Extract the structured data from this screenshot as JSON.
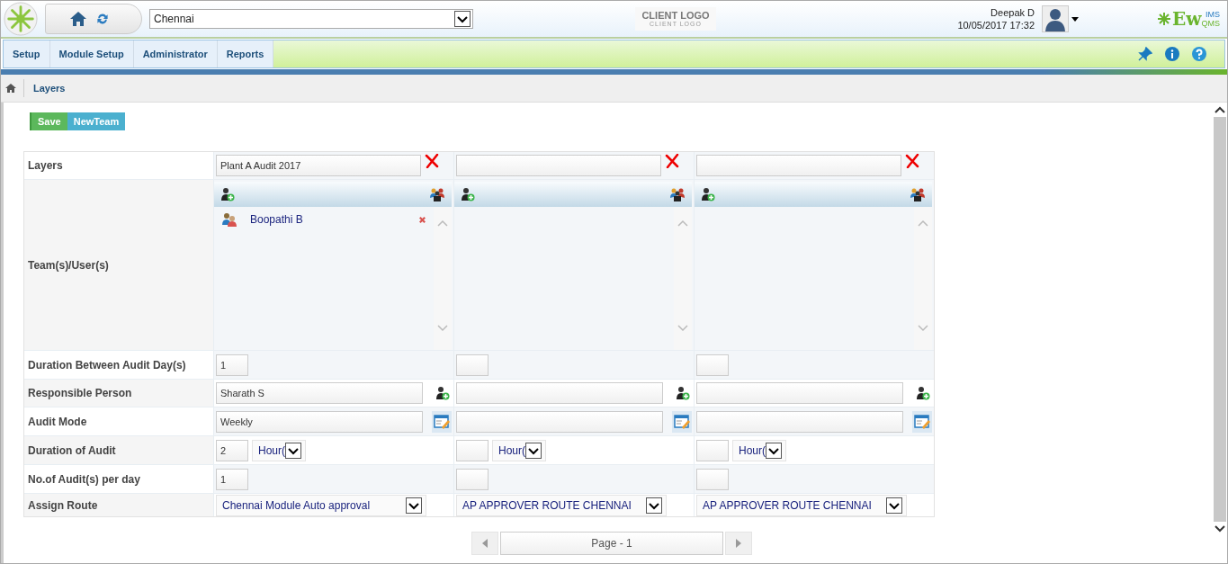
{
  "header": {
    "location": "Chennai",
    "client_logo": {
      "title": "CLIENT LOGO",
      "subtitle": "CLIENT LOGO"
    },
    "user": {
      "name": "Deepak D",
      "datetime": "10/05/2017 17:32"
    },
    "brand": {
      "main": "Ew",
      "top": "IMS",
      "bottom": "QMS"
    }
  },
  "menu": [
    {
      "label": "Setup"
    },
    {
      "label": "Module Setup"
    },
    {
      "label": "Administrator"
    },
    {
      "label": "Reports"
    }
  ],
  "breadcrumb": "Layers",
  "buttons": [
    {
      "label": "Save",
      "kind": "save"
    },
    {
      "label": "NewTeam",
      "kind": "new"
    }
  ],
  "rows": [
    {
      "label": "Layers",
      "kind": "name"
    },
    {
      "label": "Team(s)/User(s)",
      "kind": "members"
    },
    {
      "label": "Duration Between Audit Day(s)",
      "kind": "gap"
    },
    {
      "label": "Responsible Person",
      "kind": "person"
    },
    {
      "label": "Audit Mode",
      "kind": "mode"
    },
    {
      "label": "Duration of Audit",
      "kind": "duration"
    },
    {
      "label": "No.of Audit(s) per day",
      "kind": "per_day"
    },
    {
      "label": "Assign Route",
      "kind": "route"
    }
  ],
  "columns": [
    {
      "name": "Plant A Audit 2017",
      "members": [
        {
          "name": "Boopathi B"
        }
      ],
      "gap": "1",
      "person": "Sharath S",
      "mode": "Weekly",
      "duration": "2",
      "duration_unit": "Hour(",
      "per_day": "1",
      "route": "Chennai Module Auto approval"
    },
    {
      "duration_unit": "Hour(",
      "route": "AP APPROVER ROUTE CHENNAI"
    },
    {
      "duration_unit": "Hour(",
      "route": "AP APPROVER ROUTE CHENNAI"
    }
  ],
  "pager": "Page - 1"
}
